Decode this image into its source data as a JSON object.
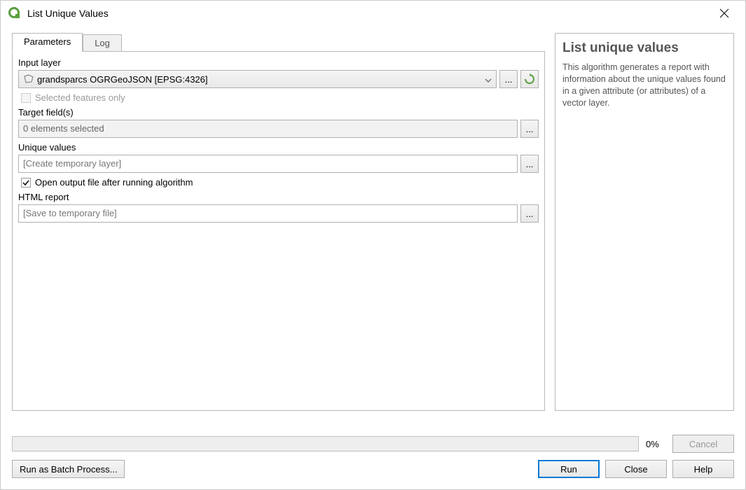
{
  "window": {
    "title": "List Unique Values"
  },
  "tabs": {
    "parameters": "Parameters",
    "log": "Log"
  },
  "labels": {
    "input_layer": "Input layer",
    "selected_only": "Selected features only",
    "target_fields": "Target field(s)",
    "unique_values": "Unique values",
    "open_output": "Open output file after running algorithm",
    "html_report": "HTML report"
  },
  "values": {
    "input_layer": "grandsparcs OGRGeoJSON [EPSG:4326]",
    "target_fields": "0 elements selected",
    "unique_values_placeholder": "[Create temporary layer]",
    "html_report_placeholder": "[Save to temporary file]"
  },
  "buttons": {
    "ellipsis": "...",
    "cancel": "Cancel",
    "batch": "Run as Batch Process...",
    "run": "Run",
    "close": "Close",
    "help": "Help"
  },
  "help": {
    "title": "List unique values",
    "text": "This algorithm generates a report with information about the unique values found in a given attribute (or attributes) of a vector layer."
  },
  "progress": {
    "percent": "0%"
  }
}
